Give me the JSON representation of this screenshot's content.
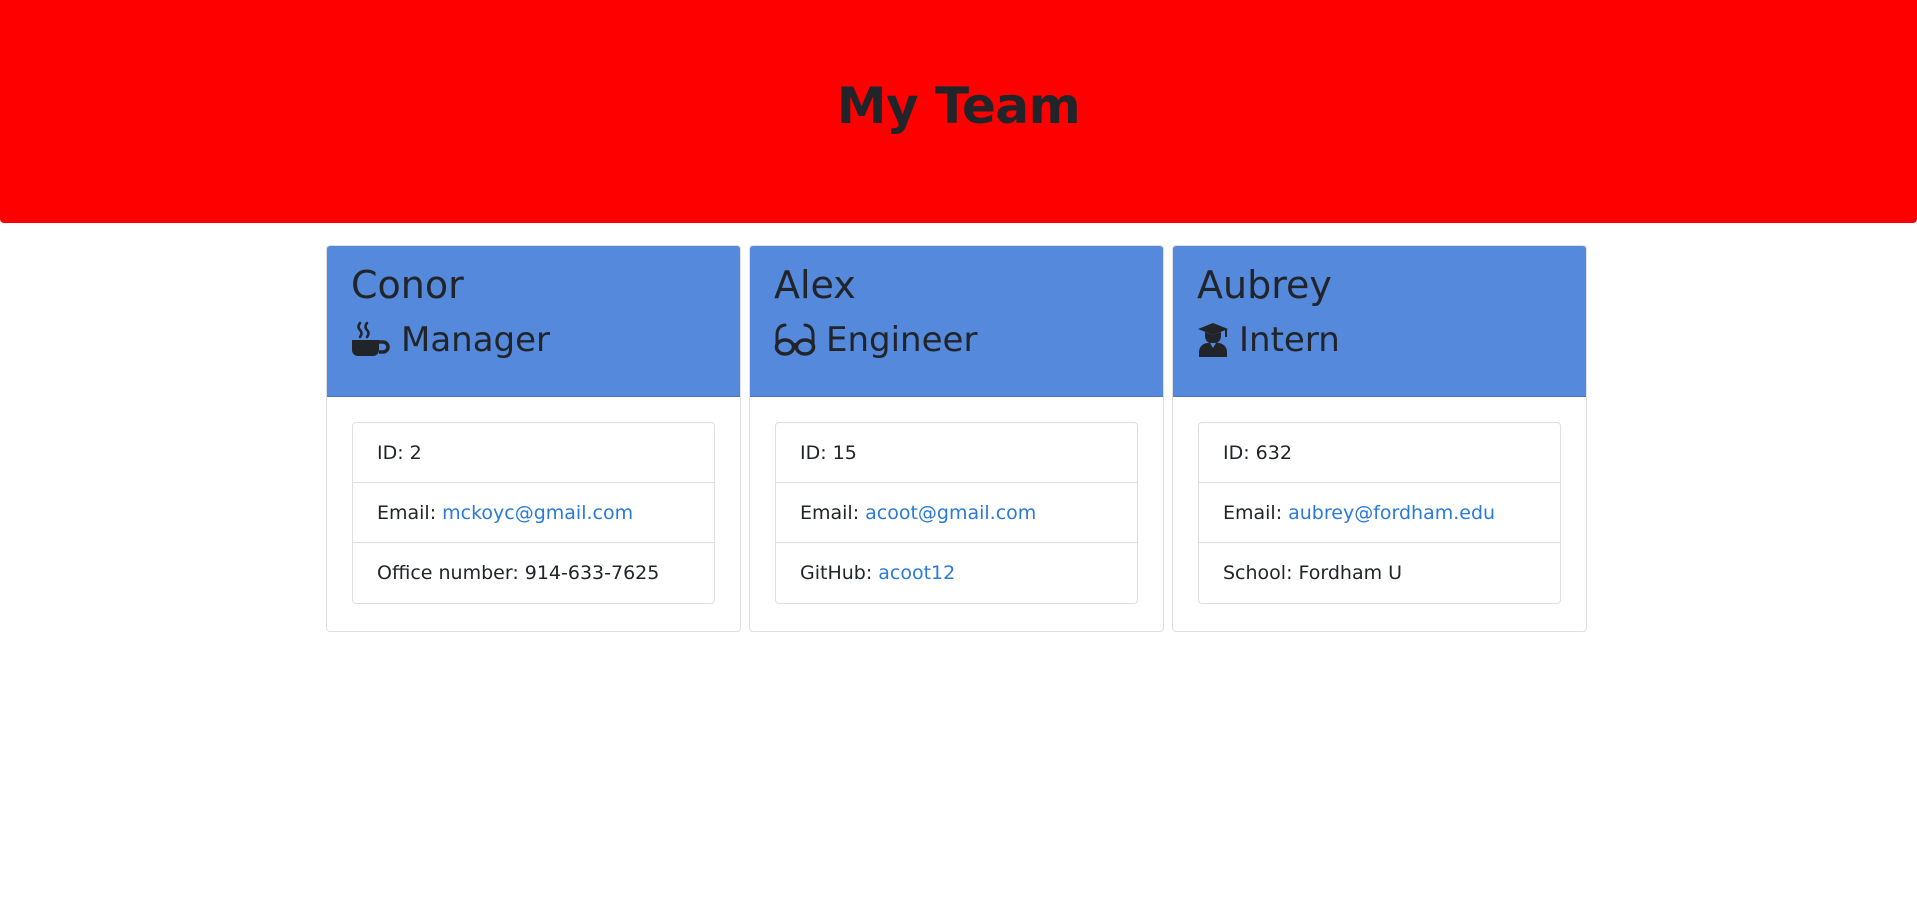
{
  "header": {
    "title": "My Team",
    "background_color": "#ff0000"
  },
  "team": [
    {
      "name": "Conor",
      "role": "Manager",
      "icon": "coffee-mug-icon",
      "id_label": "ID: 2",
      "email_label": "Email:",
      "email": "mckoyc@gmail.com",
      "extra_label": "Office number: 914-633-7625"
    },
    {
      "name": "Alex",
      "role": "Engineer",
      "icon": "glasses-icon",
      "id_label": "ID: 15",
      "email_label": "Email:",
      "email": "acoot@gmail.com",
      "extra_label": "GitHub:",
      "extra_link": "acoot12"
    },
    {
      "name": "Aubrey",
      "role": "Intern",
      "icon": "graduate-icon",
      "id_label": "ID: 632",
      "email_label": "Email:",
      "email": "aubrey@fordham.edu",
      "extra_label": "School: Fordham U"
    }
  ],
  "colors": {
    "card_header": "#5589dc",
    "link": "#2a7ad8",
    "text": "#212529"
  }
}
